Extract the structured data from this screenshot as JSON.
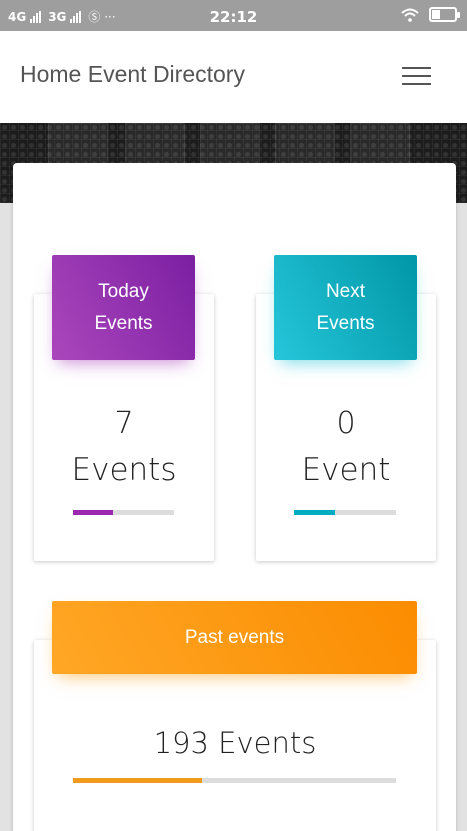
{
  "status_bar": {
    "network_1": "4G",
    "network_2": "3G",
    "extra_icons": "Ⓢ ···",
    "time": "22:12",
    "icons": [
      "signal-icon",
      "whatsapp-icon",
      "wifi-icon",
      "battery-icon"
    ]
  },
  "app_bar": {
    "title": "Home Event Directory",
    "menu_icon": "hamburger-menu-icon"
  },
  "cards": {
    "today": {
      "header_line1": "Today",
      "header_line2": "Events",
      "count": "7",
      "unit": "Events",
      "progress": 0.4,
      "color": "#9c27b0"
    },
    "next": {
      "header_line1": "Next",
      "header_line2": "Events",
      "count": "0",
      "unit": "Event",
      "progress": 0.4,
      "color": "#00acc1"
    },
    "past": {
      "header": "Past events",
      "count_text": "193 Events",
      "progress": 0.4,
      "color": "#f29a1c"
    }
  }
}
